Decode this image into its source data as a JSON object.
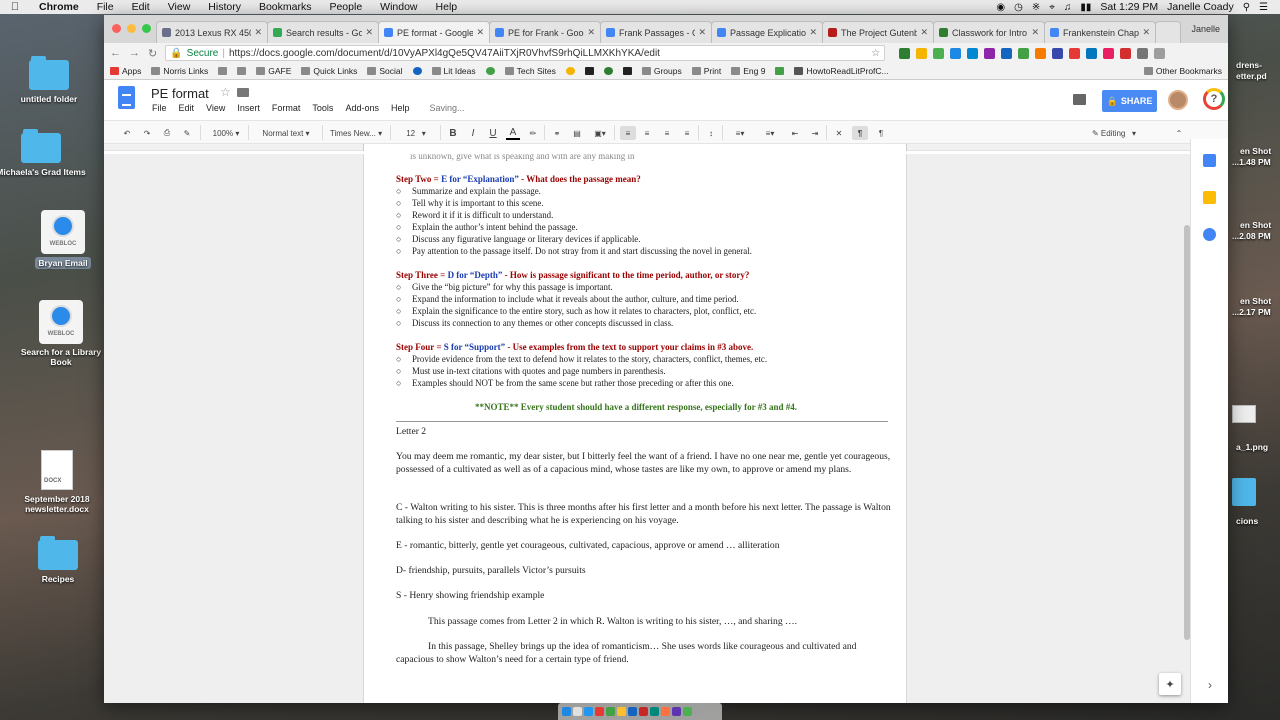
{
  "menubar": {
    "app": "Chrome",
    "items": [
      "File",
      "Edit",
      "View",
      "History",
      "Bookmarks",
      "People",
      "Window",
      "Help"
    ],
    "clock": "Sat 1:29 PM",
    "user": "Janelle Coady"
  },
  "desktop": {
    "left_icons": [
      {
        "label": "untitled folder"
      },
      {
        "label": "Michaela's Grad Items"
      },
      {
        "label": "Bryan Email",
        "badge": "WEBLOC"
      },
      {
        "label": "Search for a Library Book",
        "badge": "WEBLOC"
      },
      {
        "label": "September 2018 newsletter.docx",
        "badge": "DOCX"
      },
      {
        "label": "Recipes"
      }
    ],
    "right_labels": [
      "drens-",
      "etter.pd",
      "en Shot",
      "...1.48 PM",
      "en Shot",
      "...2.08 PM",
      "en Shot",
      "...2.17 PM",
      "a_1.png",
      "cions"
    ]
  },
  "browser": {
    "profile": "Janelle",
    "tabs": [
      {
        "title": "2013 Lexus RX 450h",
        "color": "#6b6f8a"
      },
      {
        "title": "Search results - Goo",
        "color": "#34a853"
      },
      {
        "title": "PE format - Google",
        "color": "#4285f4",
        "active": true
      },
      {
        "title": "PE for Frank - Goog",
        "color": "#4285f4"
      },
      {
        "title": "Frank Passages - Go",
        "color": "#4285f4"
      },
      {
        "title": "Passage Explication",
        "color": "#4285f4"
      },
      {
        "title": "The Project Gutenb",
        "color": "#b71c1c"
      },
      {
        "title": "Classwork for Intro",
        "color": "#2e7d32"
      },
      {
        "title": "Frankenstein Chapte",
        "color": "#4285f4"
      }
    ],
    "secure_label": "Secure",
    "url": "https://docs.google.com/document/d/10VyAPXl4gQe5QV47AiiTXjR0VhvfS9rhQiLLMXKhYKA/edit",
    "bookmarks": [
      "Apps",
      "Norris Links",
      "",
      "",
      "GAFE",
      "Quick Links",
      "Social",
      "",
      "Lit Ideas",
      "",
      "Tech Sites",
      "",
      "",
      "",
      "",
      "Groups",
      "Print",
      "Eng 9",
      "",
      "HowtoReadLitProfC...",
      "Other Bookmarks"
    ]
  },
  "docs": {
    "title": "PE format",
    "menu": [
      "File",
      "Edit",
      "View",
      "Insert",
      "Format",
      "Tools",
      "Add-ons",
      "Help"
    ],
    "saving": "Saving...",
    "share_label": "SHARE",
    "toolbar": {
      "zoom": "100%",
      "style": "Normal text",
      "font": "Times New...",
      "size": "12",
      "mode": "Editing"
    }
  },
  "content": {
    "cutoff_line": "is unknown, give what is speaking and with are any making in",
    "steps": [
      {
        "prefix": "Step Two = ",
        "letter": "E for “Explanation”",
        "rest": " - What does the passage mean?",
        "bullets": [
          "Summarize and explain the passage.",
          "Tell why it is important to this scene.",
          "Reword it if it is difficult to understand.",
          "Explain the author’s intent behind the passage.",
          "Discuss any figurative language or literary devices if applicable.",
          "Pay attention to the passage itself. Do not stray from it and start discussing the novel in general."
        ]
      },
      {
        "prefix": "Step Three = ",
        "letter": "D for “Depth”",
        "rest": " - How is passage significant to the time period, author, or story?",
        "bullets": [
          "Give the “big picture” for why this passage is important.",
          "Expand the information to include what it reveals about the author, culture, and time period.",
          "Explain the significance to the entire story, such as how it relates to characters, plot, conflict, etc.",
          "Discuss its connection to any themes or other concepts discussed in class."
        ]
      },
      {
        "prefix": "Step Four = ",
        "letter": "S for “Support”",
        "rest": " - Use examples from the text to support your claims in #3 above.",
        "bullets": [
          "Provide evidence from the text to defend how it relates to the story, characters, conflict, themes, etc.",
          "Must use in-text citations with quotes and page numbers in parenthesis.",
          "Examples should NOT be from the same scene but rather those preceding or after this one."
        ]
      }
    ],
    "note": "**NOTE** Every student should have a different response, especially for #3 and #4.",
    "bullet_symbol": "○",
    "letter_heading": "Letter 2",
    "paragraphs": [
      "You may deem me romantic, my dear sister, but I bitterly feel the want of a friend. I have no one near me, gentle yet courageous, possessed of a cultivated as well as of a capacious mind, whose tastes are like my own, to approve or amend my plans.",
      "C - Walton writing to his sister. This is three months after his first letter and a month before his next letter. The passage is Walton talking to his sister and describing what he is experiencing on his voyage.",
      "E - romantic, bitterly, gentle yet courageous, cultivated, capacious, approve or amend … alliteration",
      "D- friendship, pursuits, parallels Victor’s pursuits",
      "S - Henry showing friendship example"
    ],
    "indented": [
      "This passage comes from Letter 2 in which R. Walton is writing to his sister, …, and sharing ….",
      "In this passage, Shelley brings up the idea of romanticism… She uses words like courageous and cultivated and capacious to show Walton’s need for a certain type of friend."
    ]
  }
}
